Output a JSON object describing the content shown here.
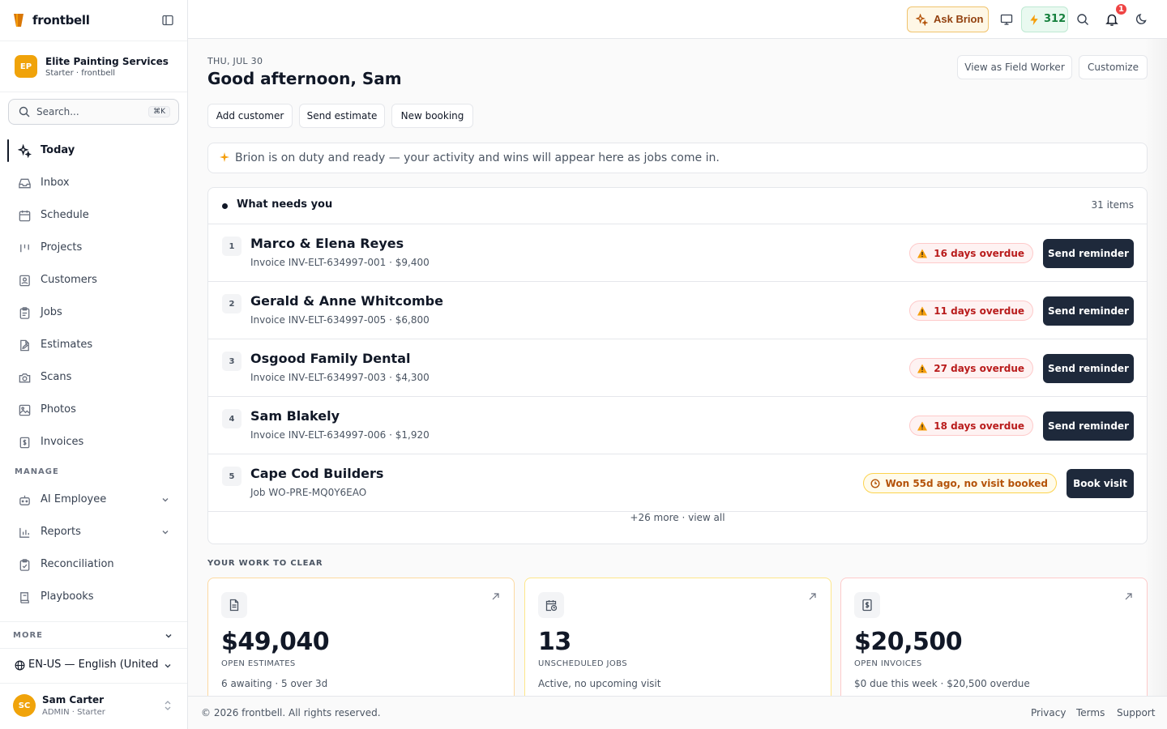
{
  "brand": {
    "name": "frontbell"
  },
  "org": {
    "initials": "EP",
    "name": "Elite Painting Services",
    "plan": "Starter · frontbell"
  },
  "search": {
    "placeholder": "Search...",
    "shortcut": "⌘K"
  },
  "nav": {
    "items": [
      {
        "label": "Today",
        "icon": "sparkles-icon"
      },
      {
        "label": "Inbox",
        "icon": "inbox-icon"
      },
      {
        "label": "Schedule",
        "icon": "calendar-icon"
      },
      {
        "label": "Projects",
        "icon": "projects-icon"
      },
      {
        "label": "Customers",
        "icon": "contacts-icon"
      },
      {
        "label": "Jobs",
        "icon": "clipboard-icon"
      },
      {
        "label": "Estimates",
        "icon": "file-edit-icon"
      },
      {
        "label": "Scans",
        "icon": "camera-icon"
      },
      {
        "label": "Photos",
        "icon": "image-icon"
      },
      {
        "label": "Invoices",
        "icon": "dollar-file-icon"
      }
    ],
    "manage_label": "MANAGE",
    "manage_items": [
      {
        "label": "AI Employee",
        "icon": "bot-icon"
      },
      {
        "label": "Reports",
        "icon": "bar-chart-icon"
      },
      {
        "label": "Reconciliation",
        "icon": "clipboard-check-icon"
      },
      {
        "label": "Playbooks",
        "icon": "book-icon"
      }
    ],
    "more_label": "MORE"
  },
  "language": {
    "label": "EN-US — English (United States)"
  },
  "user": {
    "initials": "SC",
    "name": "Sam Carter",
    "role": "ADMIN · Starter"
  },
  "topbar": {
    "ask_label": "Ask Brion",
    "credits": "312",
    "notifications": "1"
  },
  "header": {
    "date": "THU, JUL 30",
    "greeting": "Good afternoon, Sam",
    "view_as": "View as Field Worker",
    "customize": "Customize"
  },
  "quick_actions": [
    "Add customer",
    "Send estimate",
    "New booking"
  ],
  "banner": {
    "text": "Brion is on duty and ready — your activity and wins will appear here as jobs come in."
  },
  "needs": {
    "title": "What needs you",
    "count": "31 items",
    "rows": [
      {
        "num": "1",
        "name": "Marco & Elena Reyes",
        "sub": "Invoice INV-ELT-634997-001 · $9,400",
        "status": "16 days overdue",
        "status_type": "overdue",
        "action": "Send reminder"
      },
      {
        "num": "2",
        "name": "Gerald & Anne Whitcombe",
        "sub": "Invoice INV-ELT-634997-005 · $6,800",
        "status": "11 days overdue",
        "status_type": "overdue",
        "action": "Send reminder"
      },
      {
        "num": "3",
        "name": "Osgood Family Dental",
        "sub": "Invoice INV-ELT-634997-003 · $4,300",
        "status": "27 days overdue",
        "status_type": "overdue",
        "action": "Send reminder"
      },
      {
        "num": "4",
        "name": "Sam Blakely",
        "sub": "Invoice INV-ELT-634997-006 · $1,920",
        "status": "18 days overdue",
        "status_type": "overdue",
        "action": "Send reminder"
      },
      {
        "num": "5",
        "name": "Cape Cod Builders",
        "sub": "Job WO-PRE-MQ0Y6EAO",
        "status": "Won 55d ago, no visit booked",
        "status_type": "pending",
        "action": "Book visit"
      }
    ],
    "more": "+26 more · view all"
  },
  "work": {
    "label": "YOUR WORK TO CLEAR",
    "cards": [
      {
        "value": "$49,040",
        "caption": "OPEN ESTIMATES",
        "desc": "6 awaiting · 5 over 3d",
        "icon": "file-text-icon",
        "accent": "#fcd9a1"
      },
      {
        "value": "13",
        "caption": "UNSCHEDULED JOBS",
        "desc": "Active, no upcoming visit",
        "icon": "calendar-clock-icon",
        "accent": "#fde68a"
      },
      {
        "value": "$20,500",
        "caption": "OPEN INVOICES",
        "desc": "$0 due this week · $20,500 overdue",
        "icon": "dollar-file-icon",
        "accent": "#fecaca"
      }
    ]
  },
  "footer": {
    "copyright": "© 2026 frontbell. All rights reserved.",
    "links": [
      "Privacy",
      "Terms",
      "Support"
    ]
  }
}
